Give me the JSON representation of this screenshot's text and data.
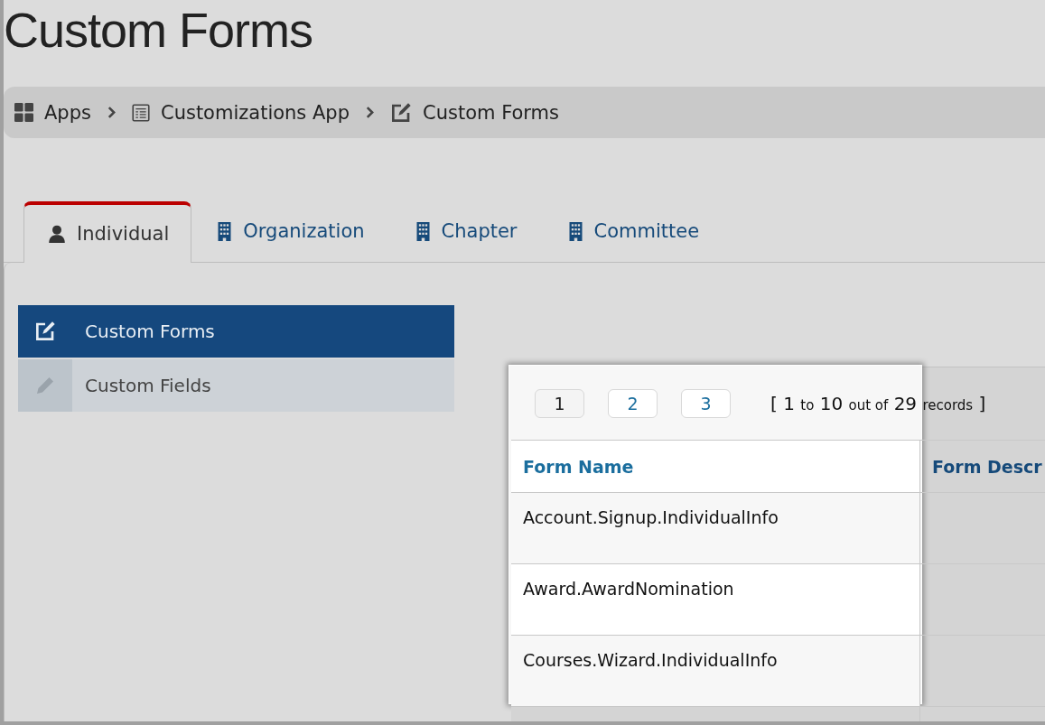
{
  "page_title": "Custom Forms",
  "breadcrumb": [
    {
      "label": "Apps",
      "kind": "grid"
    },
    {
      "label": "Customizations App",
      "kind": "list"
    },
    {
      "label": "Custom Forms",
      "kind": "edit"
    }
  ],
  "tabs": [
    {
      "label": "Individual",
      "kind": "person",
      "selected": true
    },
    {
      "label": "Organization",
      "kind": "building",
      "selected": false
    },
    {
      "label": "Chapter",
      "kind": "building",
      "selected": false
    },
    {
      "label": "Committee",
      "kind": "building",
      "selected": false
    }
  ],
  "sidebar": {
    "items": [
      {
        "label": "Custom Forms",
        "kind": "edit",
        "selected": true
      },
      {
        "label": "Custom Fields",
        "kind": "pencil",
        "selected": false
      }
    ]
  },
  "pager": {
    "pages": [
      {
        "label": "1",
        "selected": true
      },
      {
        "label": "2",
        "selected": false
      },
      {
        "label": "3",
        "selected": false
      }
    ],
    "summary": [
      {
        "text": "[ 1",
        "kind": "number"
      },
      {
        "text": "to",
        "kind": "word"
      },
      {
        "text": "10",
        "kind": "number"
      },
      {
        "text": "out of",
        "kind": "word"
      },
      {
        "text": "29",
        "kind": "number"
      },
      {
        "text": "records",
        "kind": "word"
      },
      {
        "text": "]",
        "kind": "number"
      }
    ]
  },
  "table": {
    "columns": [
      "Form Name",
      "Form Descr"
    ],
    "rows": [
      {
        "form_name": "Account.Signup.IndividualInfo"
      },
      {
        "form_name": "Award.AwardNomination"
      },
      {
        "form_name": "Courses.Wizard.IndividualInfo"
      }
    ]
  }
}
